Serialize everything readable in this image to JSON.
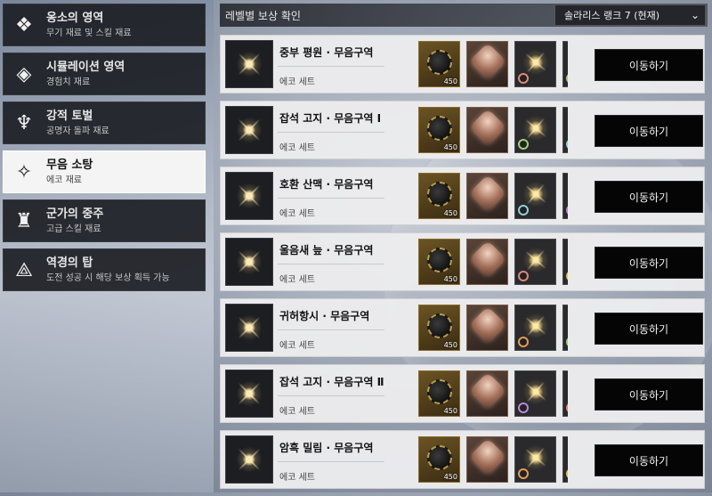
{
  "sidebar": {
    "items": [
      {
        "title": "옹소의 영역",
        "sub": "무기 재료 및 스킬 재료",
        "icon": "diamond-cluster-icon"
      },
      {
        "title": "시뮬레이션 영역",
        "sub": "경험치 재료",
        "icon": "cube-icon"
      },
      {
        "title": "강적 토벌",
        "sub": "공명자 돌파 재료",
        "icon": "trident-crest-icon"
      },
      {
        "title": "무음 소탕",
        "sub": "에코 재료",
        "icon": "twin-star-icon"
      },
      {
        "title": "군가의 중주",
        "sub": "고급 스킬 재료",
        "icon": "tower-icon"
      },
      {
        "title": "역경의 탑",
        "sub": "도전 성공 시 해당 보상 획득 가능",
        "icon": "triangle-eye-icon"
      }
    ]
  },
  "header": {
    "title": "레벨별 보상 확인",
    "dropdown": "솔라리스 랭크 7 (현재)"
  },
  "rows": [
    {
      "name": "중부 평원 · 무음구역",
      "sub": "에코 세트",
      "qty": "450",
      "button": "이동하기"
    },
    {
      "name": "잡석 고지 · 무음구역 Ⅰ",
      "sub": "에코 세트",
      "qty": "450",
      "button": "이동하기"
    },
    {
      "name": "호환 산맥 · 무음구역",
      "sub": "에코 세트",
      "qty": "450",
      "button": "이동하기"
    },
    {
      "name": "울음새 늪 · 무음구역",
      "sub": "에코 세트",
      "qty": "450",
      "button": "이동하기"
    },
    {
      "name": "귀허항시 · 무음구역",
      "sub": "에코 세트",
      "qty": "450",
      "button": "이동하기"
    },
    {
      "name": "잡석 고지 · 무음구역 Ⅱ",
      "sub": "에코 세트",
      "qty": "450",
      "button": "이동하기"
    },
    {
      "name": "암흑 밀림 · 무음구역",
      "sub": "에코 세트",
      "qty": "450",
      "button": "이동하기"
    }
  ]
}
